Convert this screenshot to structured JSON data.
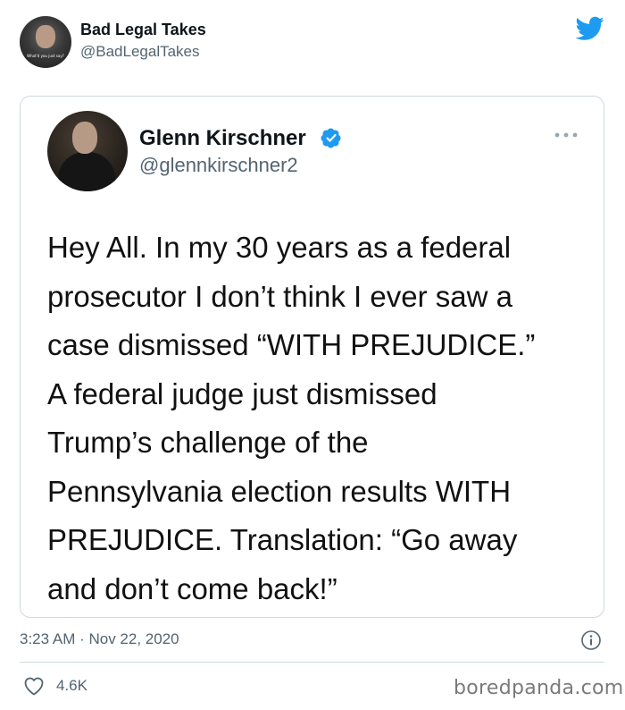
{
  "tweet": {
    "author": {
      "name": "Bad Legal Takes",
      "handle": "@BadLegalTakes",
      "avatar_caption": "What'd you just say?"
    },
    "timestamp": "3:23 AM · Nov 22, 2020",
    "likes": "4.6K",
    "brand_color": "#1d9bf0"
  },
  "quoted_tweet": {
    "author": {
      "name": "Glenn Kirschner",
      "handle": "@glennkirschner2",
      "verified": true
    },
    "text_lines": [
      "Hey All. In my 30 years as a federal",
      "prosecutor I don’t think I ever saw a",
      "case dismissed “WITH PREJUDICE.”",
      "A federal judge just dismissed",
      "Trump’s challenge of the",
      "Pennsylvania election results WITH",
      "PREJUDICE. Translation: “Go away",
      "and don’t come back!”"
    ]
  },
  "icons": {
    "logo": "twitter-bird-icon",
    "verified": "verified-badge-icon",
    "more": "more-options-icon",
    "info": "info-icon",
    "like": "heart-icon"
  },
  "watermark": "boredpanda.com"
}
